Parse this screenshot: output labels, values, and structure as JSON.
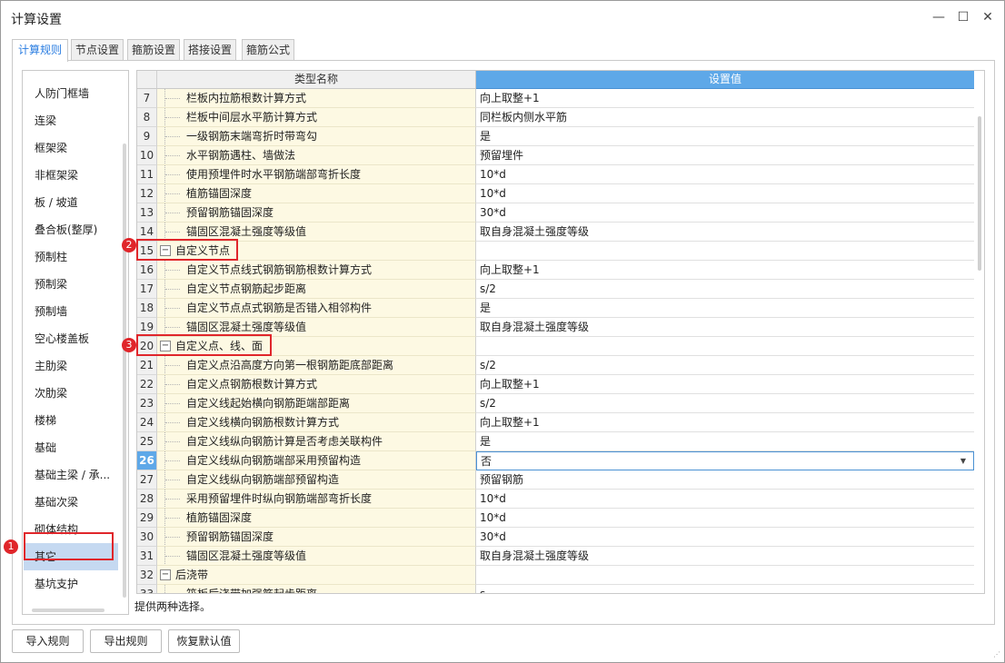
{
  "window": {
    "title": "计算设置"
  },
  "tabs": [
    {
      "label": "计算规则",
      "active": true
    },
    {
      "label": "节点设置",
      "active": false
    },
    {
      "label": "箍筋设置",
      "active": false
    },
    {
      "label": "搭接设置",
      "active": false
    },
    {
      "label": "箍筋公式",
      "active": false
    }
  ],
  "sidebar": {
    "items": [
      {
        "label": "人防门框墙"
      },
      {
        "label": "连梁"
      },
      {
        "label": "框架梁"
      },
      {
        "label": "非框架梁"
      },
      {
        "label": "板 / 坡道"
      },
      {
        "label": "叠合板(整厚)"
      },
      {
        "label": "预制柱"
      },
      {
        "label": "预制梁"
      },
      {
        "label": "预制墙"
      },
      {
        "label": "空心楼盖板"
      },
      {
        "label": "主肋梁"
      },
      {
        "label": "次肋梁"
      },
      {
        "label": "楼梯"
      },
      {
        "label": "基础"
      },
      {
        "label": "基础主梁 / 承..."
      },
      {
        "label": "基础次梁"
      },
      {
        "label": "砌体结构"
      },
      {
        "label": "其它",
        "selected": true
      },
      {
        "label": "基坑支护"
      }
    ]
  },
  "grid": {
    "header_name": "类型名称",
    "header_value": "设置值",
    "rows": [
      {
        "num": "7",
        "name": "栏板内拉筋根数计算方式",
        "value": "向上取整+1"
      },
      {
        "num": "8",
        "name": "栏板中间层水平筋计算方式",
        "value": "同栏板内侧水平筋"
      },
      {
        "num": "9",
        "name": "一级钢筋末端弯折时带弯勾",
        "value": "是"
      },
      {
        "num": "10",
        "name": "水平钢筋遇柱、墙做法",
        "value": "预留埋件"
      },
      {
        "num": "11",
        "name": "使用预埋件时水平钢筋端部弯折长度",
        "value": "10*d"
      },
      {
        "num": "12",
        "name": "植筋锚固深度",
        "value": "10*d"
      },
      {
        "num": "13",
        "name": "预留钢筋锚固深度",
        "value": "30*d"
      },
      {
        "num": "14",
        "name": "锚固区混凝土强度等级值",
        "value": "取自身混凝土强度等级"
      },
      {
        "num": "15",
        "name": "自定义节点",
        "value": "",
        "group": true,
        "toggle": "−"
      },
      {
        "num": "16",
        "name": "自定义节点线式钢筋钢筋根数计算方式",
        "value": "向上取整+1"
      },
      {
        "num": "17",
        "name": "自定义节点钢筋起步距离",
        "value": "s/2"
      },
      {
        "num": "18",
        "name": "自定义节点点式钢筋是否错入相邻构件",
        "value": "是"
      },
      {
        "num": "19",
        "name": "锚固区混凝土强度等级值",
        "value": "取自身混凝土强度等级"
      },
      {
        "num": "20",
        "name": "自定义点、线、面",
        "value": "",
        "group": true,
        "toggle": "−"
      },
      {
        "num": "21",
        "name": "自定义点沿高度方向第一根钢筋距底部距离",
        "value": "s/2"
      },
      {
        "num": "22",
        "name": "自定义点钢筋根数计算方式",
        "value": "向上取整+1"
      },
      {
        "num": "23",
        "name": "自定义线起始横向钢筋距端部距离",
        "value": "s/2"
      },
      {
        "num": "24",
        "name": "自定义线横向钢筋根数计算方式",
        "value": "向上取整+1"
      },
      {
        "num": "25",
        "name": "自定义线纵向钢筋计算是否考虑关联构件",
        "value": "是"
      },
      {
        "num": "26",
        "name": "自定义线纵向钢筋端部采用预留构造",
        "value": "否",
        "selected": true,
        "dropdown": "▼"
      },
      {
        "num": "27",
        "name": "自定义线纵向钢筋端部预留构造",
        "value": "预留钢筋"
      },
      {
        "num": "28",
        "name": "采用预留埋件时纵向钢筋端部弯折长度",
        "value": "10*d"
      },
      {
        "num": "29",
        "name": "植筋锚固深度",
        "value": "10*d"
      },
      {
        "num": "30",
        "name": "预留钢筋锚固深度",
        "value": "30*d"
      },
      {
        "num": "31",
        "name": "锚固区混凝土强度等级值",
        "value": "取自身混凝土强度等级"
      },
      {
        "num": "32",
        "name": "后浇带",
        "value": "",
        "group": true,
        "toggle": "−"
      },
      {
        "num": "33",
        "name": "筏板后浇带加强筋起步距离",
        "value": "s"
      }
    ]
  },
  "annotations": [
    {
      "badge": "1"
    },
    {
      "badge": "2"
    },
    {
      "badge": "3"
    }
  ],
  "hint": "提供两种选择。",
  "buttons": {
    "import": "导入规则",
    "export": "导出规则",
    "restore": "恢复默认值"
  },
  "controls": {
    "minimize": "—",
    "maximize": "☐",
    "close": "✕"
  },
  "colors": {
    "accent": "#5ea8e8",
    "selection": "#c5d9f1",
    "annotation": "#e0262b",
    "name_column": "#fdf9e3"
  }
}
